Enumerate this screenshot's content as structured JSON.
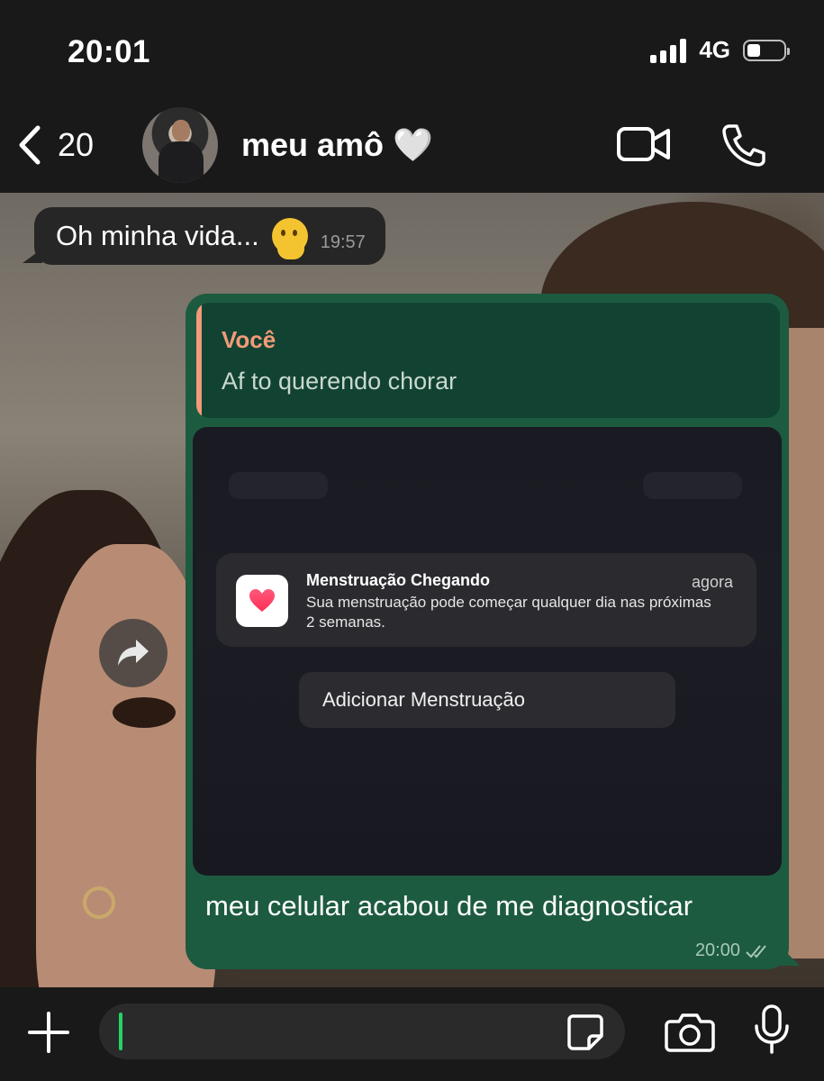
{
  "status_bar": {
    "time": "20:01",
    "network": "4G"
  },
  "header": {
    "back_count": "20",
    "contact_name": "meu amô 🤍"
  },
  "messages": {
    "incoming": {
      "text": "Oh minha vida...",
      "time": "19:57"
    },
    "outgoing": {
      "quote_author": "Você",
      "quote_text": "Af to querendo chorar",
      "caption": "meu celular acabou de me diagnosticar",
      "time": "20:00"
    }
  },
  "screenshot": {
    "notification_title": "Menstruação Chegando",
    "notification_time": "agora",
    "notification_body": "Sua menstruação pode começar qualquer dia nas próximas 2 semanas.",
    "action_label": "Adicionar Menstruação"
  },
  "colors": {
    "outgoing_bubble": "#1d5b40",
    "quote_accent": "#f29b79",
    "caret": "#25d366"
  }
}
